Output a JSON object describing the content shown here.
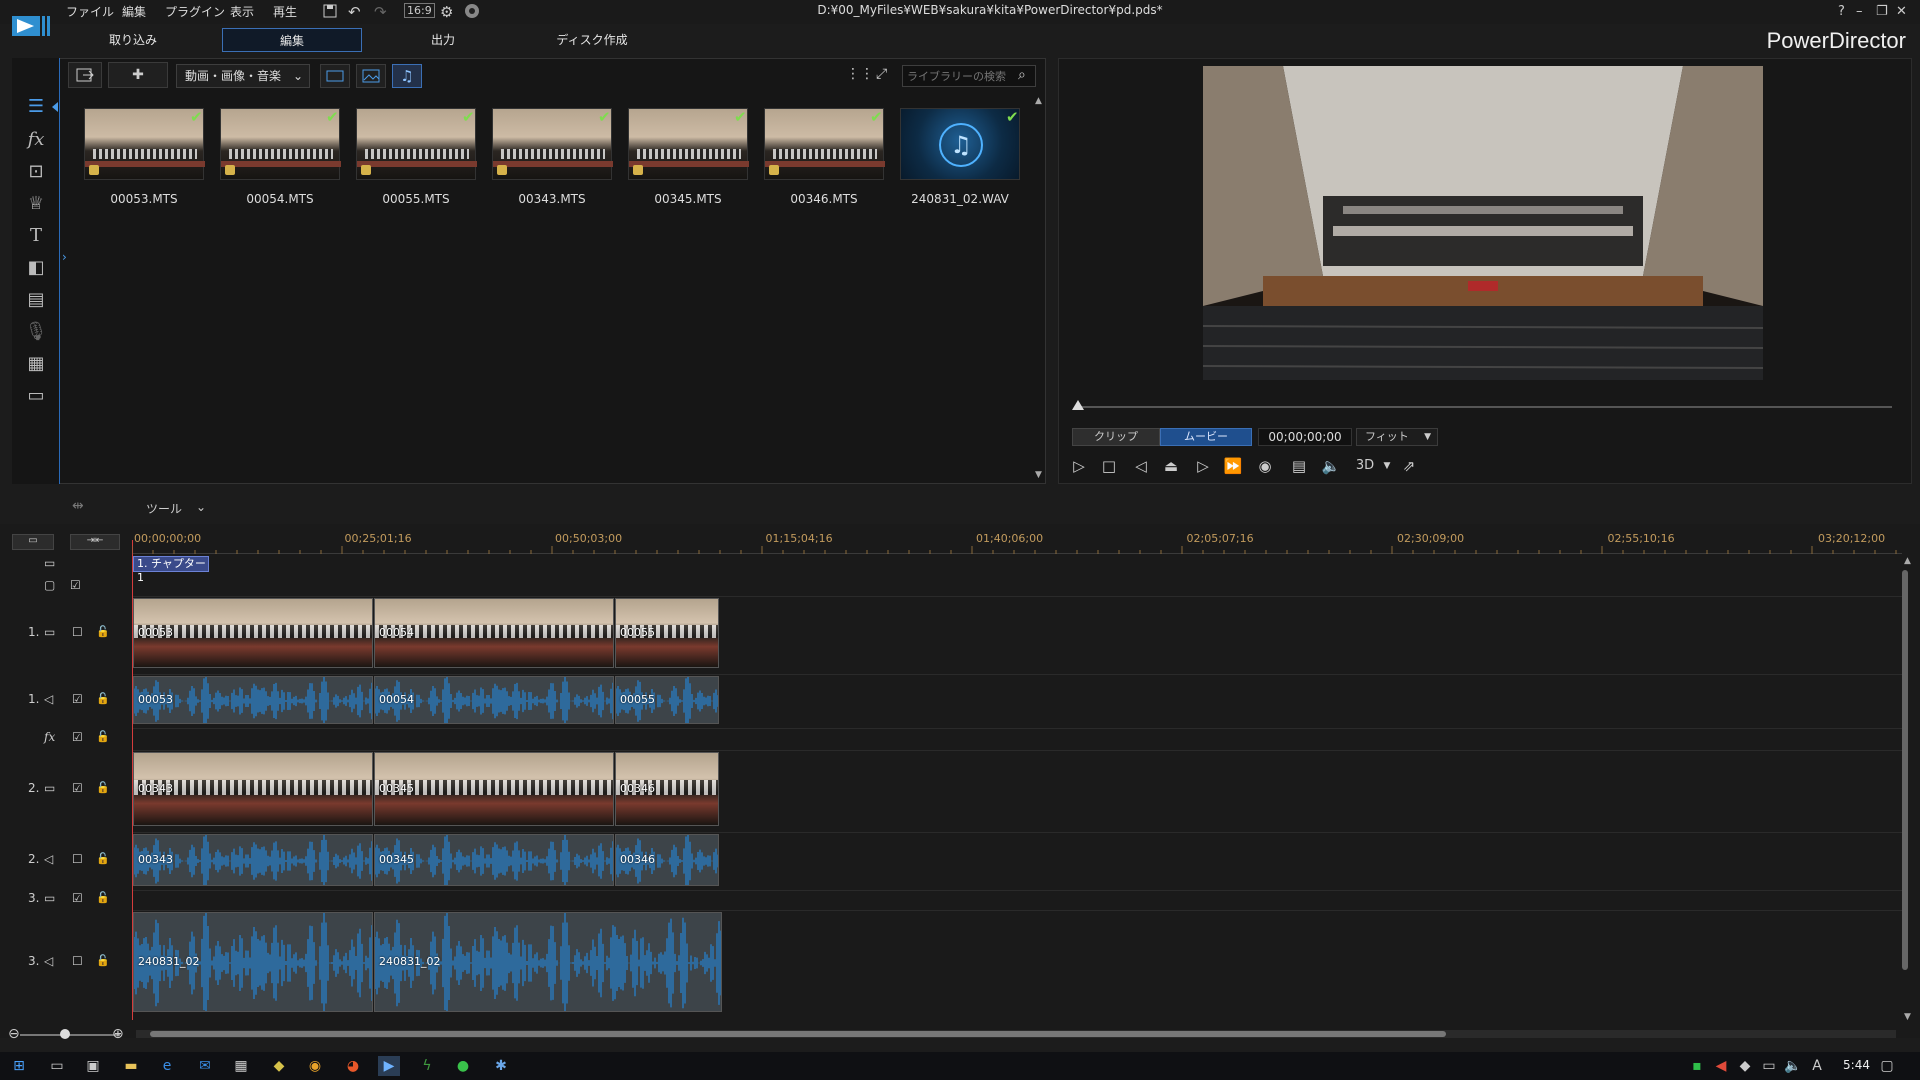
{
  "titlebar": {
    "menus": [
      "ファイル",
      "編集",
      "プラグイン",
      "表示",
      "再生"
    ],
    "aspect_ratio": "16:9",
    "window_title": "D:¥00_MyFiles¥WEB¥sakura¥kita¥PowerDirector¥pd.pds*",
    "controls": [
      "?",
      "–",
      "❐",
      "✕"
    ]
  },
  "mode_tabs": [
    "取り込み",
    "編集",
    "出力",
    "ディスク作成"
  ],
  "brand": "PowerDirector",
  "library": {
    "filter": "動画・画像・音楽",
    "search_placeholder": "ライブラリーの検索",
    "media": [
      {
        "name": "00053.MTS",
        "type": "video"
      },
      {
        "name": "00054.MTS",
        "type": "video"
      },
      {
        "name": "00055.MTS",
        "type": "video"
      },
      {
        "name": "00343.MTS",
        "type": "video"
      },
      {
        "name": "00345.MTS",
        "type": "video"
      },
      {
        "name": "00346.MTS",
        "type": "video"
      },
      {
        "name": "240831_02.WAV",
        "type": "audio"
      }
    ]
  },
  "preview": {
    "clip_label": "クリップ",
    "movie_label": "ムービー",
    "timecode": "00;00;00;00",
    "fit": "フィット",
    "mode_3d": "3D"
  },
  "toolbar": {
    "tools_label": "ツール"
  },
  "timeline": {
    "ruler": [
      "00;00;00;00",
      "00;25;01;16",
      "00;50;03;00",
      "01;15;04;16",
      "01;40;06;00",
      "02;05;07;16",
      "02;30;09;00",
      "02;55;10;16",
      "03;20;12;00"
    ],
    "chapter": "1. チャプター 1",
    "tracks": [
      {
        "id": "1",
        "kind": "video",
        "clips": [
          "00053",
          "00054",
          "00055"
        ]
      },
      {
        "id": "1",
        "kind": "audio",
        "clips": [
          "00053",
          "00054",
          "00055"
        ]
      },
      {
        "id": "fx",
        "kind": "fx",
        "clips": []
      },
      {
        "id": "2",
        "kind": "video",
        "clips": [
          "00343",
          "00345",
          "00346"
        ]
      },
      {
        "id": "2",
        "kind": "audio",
        "clips": [
          "00343",
          "00345",
          "00346"
        ]
      },
      {
        "id": "3",
        "kind": "video",
        "clips": []
      },
      {
        "id": "3",
        "kind": "audio",
        "clips": [
          "240831_02",
          "240831_02"
        ]
      }
    ],
    "track_labels": {
      "t1v": "1.",
      "t1a": "1.",
      "t2v": "2.",
      "t2a": "2.",
      "t3v": "3.",
      "t3a": "3.",
      "fx": "fx"
    }
  },
  "taskbar": {
    "clock": "5:44"
  },
  "colors": {
    "accent": "#3b6fb5",
    "check": "#7fdc4f",
    "playhead": "#d43c3c",
    "ruler_text": "#c29b5d",
    "wave": "#2a77b8"
  }
}
